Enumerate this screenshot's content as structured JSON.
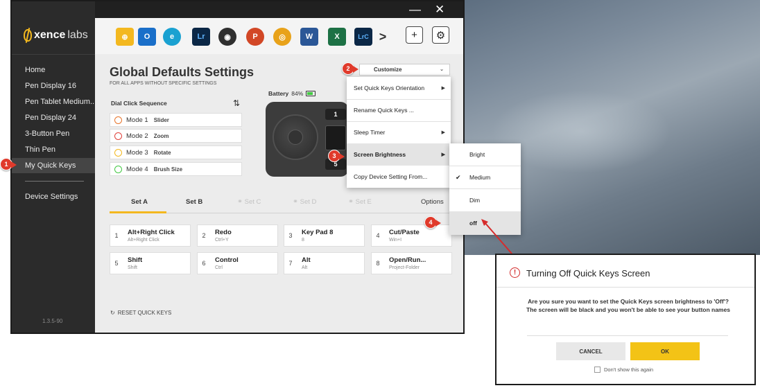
{
  "app": {
    "brand": "xencelabs",
    "brand_bold": "xence",
    "brand_thin": "labs",
    "version": "1.3.5-90",
    "window_controls": {
      "minimize": "—",
      "close": "✕"
    }
  },
  "sidebar": {
    "items": [
      {
        "label": "Home"
      },
      {
        "label": "Pen Display 16"
      },
      {
        "label": "Pen Tablet Medium..."
      },
      {
        "label": "Pen Display 24"
      },
      {
        "label": "3-Button Pen"
      },
      {
        "label": "Thin Pen"
      },
      {
        "label": "My Quick Keys",
        "active": true
      }
    ],
    "device_settings": "Device Settings"
  },
  "toolbar": {
    "apps": [
      {
        "name": "globe-icon",
        "label": "⊕",
        "color": "#f3b81f"
      },
      {
        "name": "outlook-icon",
        "label": "O",
        "color": "#1a6fc9"
      },
      {
        "name": "edge-icon",
        "label": "e",
        "color": "#1aa1d1"
      },
      {
        "name": "lightroom-icon",
        "label": "Lr",
        "color": "#0b2746"
      },
      {
        "name": "camera-icon",
        "label": "◉",
        "color": "#2f2f2f"
      },
      {
        "name": "powerpoint-icon",
        "label": "P",
        "color": "#d24726"
      },
      {
        "name": "chrome-icon",
        "label": "◎",
        "color": "#e8a21a"
      },
      {
        "name": "word-icon",
        "label": "W",
        "color": "#2b5797"
      },
      {
        "name": "excel-icon",
        "label": "X",
        "color": "#1d7145"
      },
      {
        "name": "lightroom-classic-icon",
        "label": "LrC",
        "color": "#0b2746"
      }
    ],
    "more": ">",
    "add": "+",
    "settings": "⚙"
  },
  "main": {
    "title": "Global Defaults Settings",
    "subtitle": "FOR ALL APPS WITHOUT SPECIFIC SETTINGS",
    "dial": {
      "title": "Dial Click Sequence",
      "sort_glyph": "⇅",
      "modes": [
        {
          "label": "Mode 1",
          "value": "Slider",
          "color": "#e8742a"
        },
        {
          "label": "Mode 2",
          "value": "Zoom",
          "color": "#e0403a"
        },
        {
          "label": "Mode 3",
          "value": "Rotate",
          "color": "#f3b81f"
        },
        {
          "label": "Mode 4",
          "value": "Brush Size",
          "color": "#43c843"
        }
      ]
    },
    "battery": {
      "label": "Battery",
      "percent": "84%",
      "level": 0.84
    },
    "device_buttons": {
      "top": "1",
      "bottom": "5"
    },
    "tabs": [
      {
        "label": "Set A",
        "active": true
      },
      {
        "label": "Set B"
      },
      {
        "label": "Set C",
        "disabled": true
      },
      {
        "label": "Set D",
        "disabled": true
      },
      {
        "label": "Set E",
        "disabled": true
      },
      {
        "label": "Options"
      }
    ],
    "keys": [
      {
        "num": "1",
        "name": "Alt+Right Click",
        "sub": "Alt+Right Click"
      },
      {
        "num": "2",
        "name": "Redo",
        "sub": "Ctrl+Y"
      },
      {
        "num": "3",
        "name": "Key Pad 8",
        "sub": "8"
      },
      {
        "num": "4",
        "name": "Cut/Paste",
        "sub": "Win+I"
      },
      {
        "num": "5",
        "name": "Shift",
        "sub": "Shift"
      },
      {
        "num": "6",
        "name": "Control",
        "sub": "Ctrl"
      },
      {
        "num": "7",
        "name": "Alt",
        "sub": "Alt"
      },
      {
        "num": "8",
        "name": "Open/Run...",
        "sub": "Project-Folder"
      }
    ],
    "reset": "RESET QUICK KEYS"
  },
  "customize": {
    "label": "Customize",
    "menu": [
      {
        "label": "Set Quick Keys Orientation",
        "submenu": true
      },
      {
        "label": "Rename Quick Keys ..."
      },
      {
        "label": "Sleep Timer",
        "submenu": true
      },
      {
        "label": "Screen Brightness",
        "submenu": true,
        "highlighted": true
      },
      {
        "label": "Copy Device Setting From..."
      }
    ],
    "brightness": [
      {
        "label": "Bright"
      },
      {
        "label": "Medium",
        "checked": true
      },
      {
        "label": "Dim"
      },
      {
        "label": "off",
        "highlighted": true
      }
    ]
  },
  "callouts": [
    "1",
    "2",
    "3",
    "4"
  ],
  "dialog": {
    "title": "Turning Off Quick Keys Screen",
    "message": "Are you sure you want to set the Quick Keys screen brightness to 'Off'? The screen will be black and you won't be able to see your button names",
    "cancel": "CANCEL",
    "ok": "OK",
    "dont_show": "Don't show this again"
  },
  "colors": {
    "accent": "#f3b81f",
    "callout": "#e03a2b",
    "sidebar": "#2b2b2b"
  }
}
